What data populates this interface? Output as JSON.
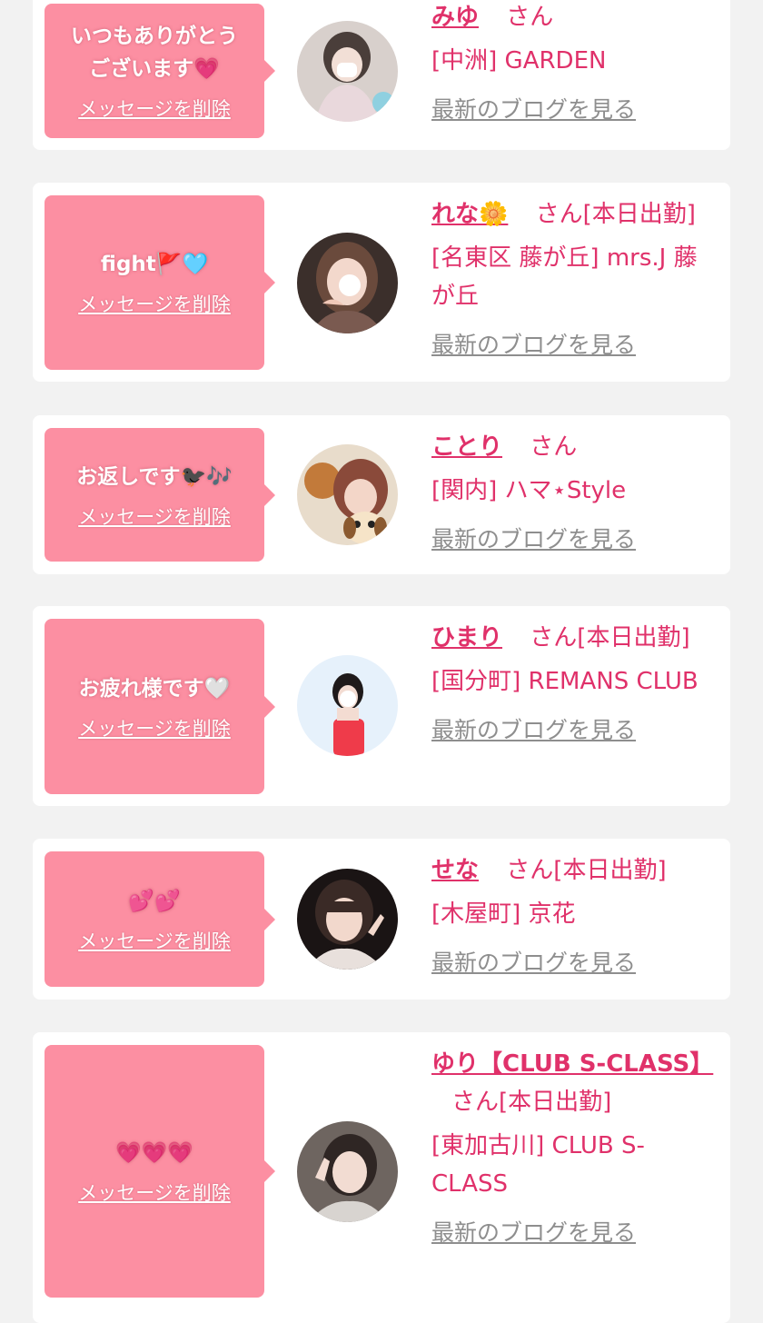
{
  "delete_label": "メッセージを削除",
  "san_label": "さん",
  "blog_label": "最新のブログを見る",
  "colors": {
    "background": "#f2f2f2",
    "card": "#ffffff",
    "bubble": "#fc8fa2",
    "accent": "#e0316a",
    "link_gray": "#8e8e8e"
  },
  "items": [
    {
      "message_line1": "いつもありがとう",
      "message_line2": "ございます💗",
      "name": "みゆ",
      "status": "",
      "shop": "[中洲] GARDEN"
    },
    {
      "message_line1": "fight🚩🩵",
      "message_line2": "",
      "name": "れな🌼",
      "status": "[本日出勤]",
      "shop": "[名東区 藤が丘] mrs.J 藤が丘"
    },
    {
      "message_line1": "お返しです🐦‍⬛🎶",
      "message_line2": "",
      "name": "ことり",
      "status": "",
      "shop": "[関内] ハマ⋆Style"
    },
    {
      "message_line1": "お疲れ様です🤍",
      "message_line2": "",
      "name": "ひまり",
      "status": "[本日出勤]",
      "shop": "[国分町] REMANS CLUB"
    },
    {
      "message_line1": "💕💕",
      "message_line2": "",
      "name": "せな",
      "status": "[本日出勤]",
      "shop": "[木屋町] 京花"
    },
    {
      "message_line1": "💗💗💗",
      "message_line2": "",
      "name": "ゆり【CLUB S-CLASS】",
      "status": "[本日出勤]",
      "shop": "[東加古川] CLUB S-CLASS"
    }
  ]
}
